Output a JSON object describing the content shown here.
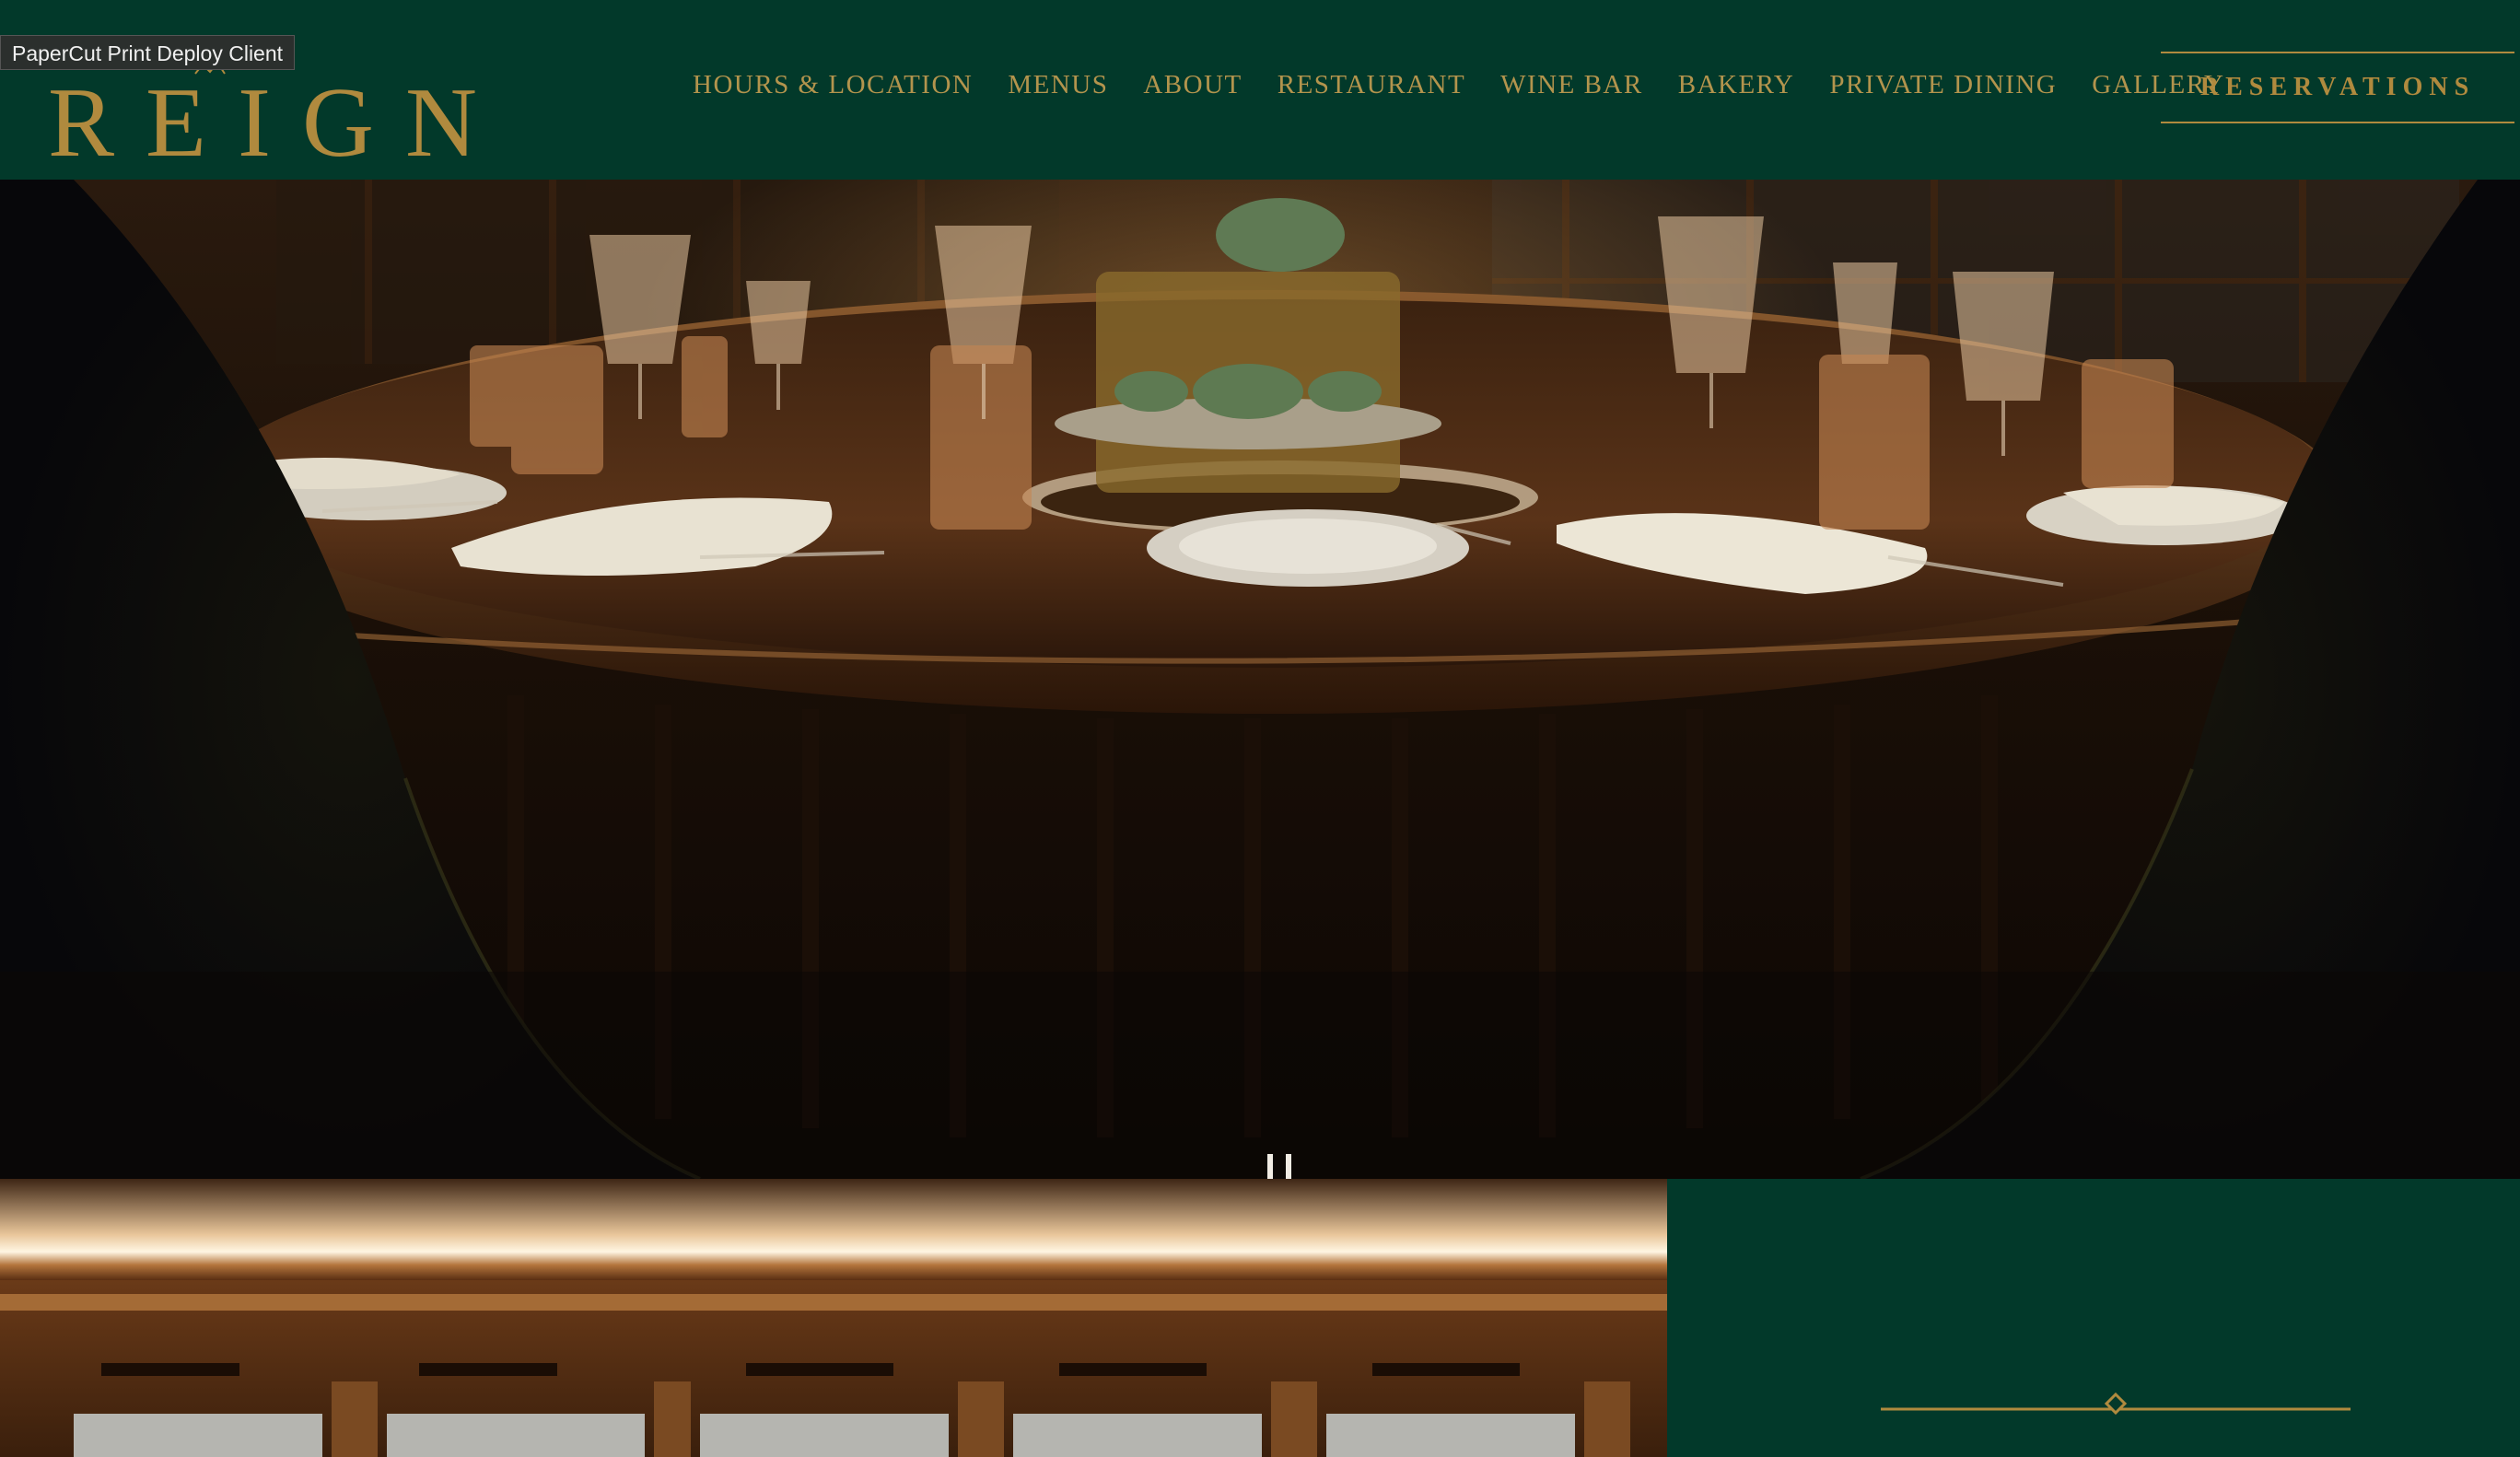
{
  "tooltip": {
    "text": "PaperCut Print Deploy Client"
  },
  "brand": {
    "name": "REIGN"
  },
  "nav": {
    "items": [
      {
        "label": "HOURS & LOCATION"
      },
      {
        "label": "MENUS"
      },
      {
        "label": "ABOUT"
      },
      {
        "label": "RESTAURANT"
      },
      {
        "label": "WINE BAR"
      },
      {
        "label": "BAKERY"
      },
      {
        "label": "PRIVATE DINING"
      },
      {
        "label": "GALLERY"
      }
    ],
    "cta_label": "RESERVATIONS"
  },
  "carousel": {
    "slide_count": 6,
    "active_index": 6,
    "pause_icon": "pause-icon"
  },
  "colors": {
    "brand_green": "#02392a",
    "gold": "#b08a3e",
    "nav_text": "#b3944d"
  }
}
